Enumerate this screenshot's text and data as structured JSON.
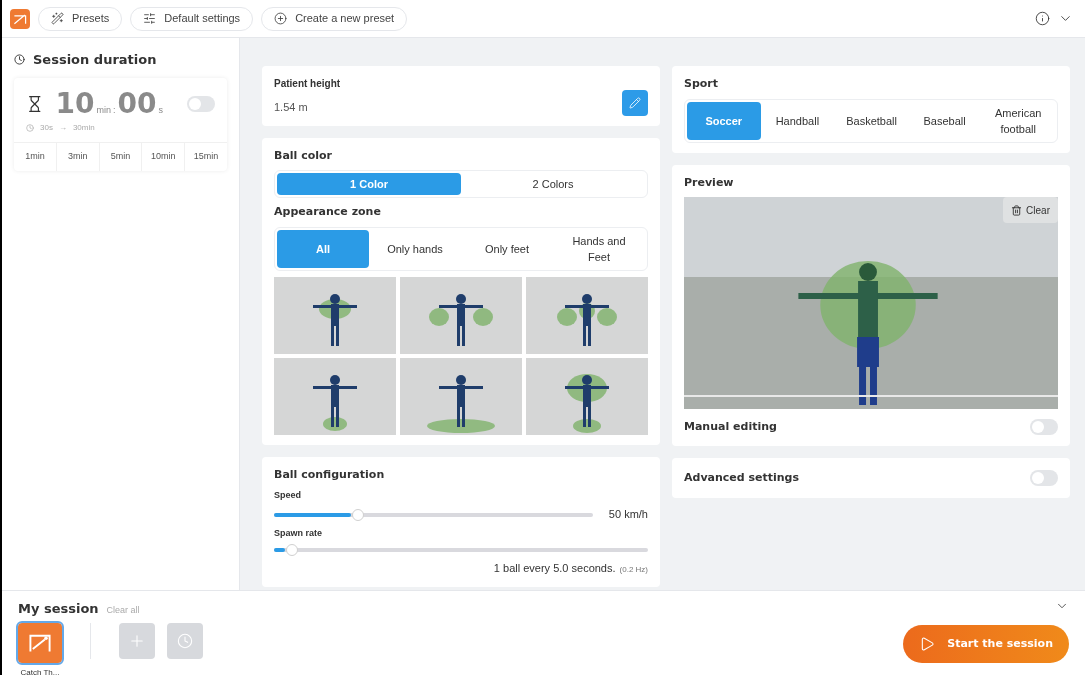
{
  "toolbar": {
    "buttons": [
      {
        "kind": "wand",
        "label": "Presets"
      },
      {
        "kind": "sliders",
        "label": "Default settings"
      },
      {
        "kind": "plus",
        "label": "Create a new preset"
      }
    ]
  },
  "session_duration": {
    "title": "Session duration",
    "minutes": "10",
    "min_unit": "min",
    "separator": ":",
    "seconds": "00",
    "sec_unit": "s",
    "timer_on": false,
    "range_min": "30s",
    "range_arrow": "→",
    "range_max": "30min",
    "presets": [
      "1min",
      "3min",
      "5min",
      "10min",
      "15min"
    ]
  },
  "patient_height": {
    "label": "Patient height",
    "value": "1.54 m"
  },
  "ball_color": {
    "title": "Ball color",
    "options": [
      {
        "label": "1 Color",
        "selected": true
      },
      {
        "label": "2 Colors",
        "selected": false
      }
    ]
  },
  "appearance_zone": {
    "title": "Appearance zone",
    "options": [
      {
        "label": "All",
        "selected": true
      },
      {
        "label": "Only hands",
        "selected": false
      },
      {
        "label": "Only feet",
        "selected": false
      },
      {
        "label": "Hands and Feet",
        "selected": false
      }
    ],
    "thumbnails": [
      {
        "kind": "chest"
      },
      {
        "kind": "hands"
      },
      {
        "kind": "hands-chest"
      },
      {
        "kind": "feet"
      },
      {
        "kind": "feet-wide"
      },
      {
        "kind": "chest-feet"
      }
    ]
  },
  "ball_configuration": {
    "title": "Ball configuration",
    "sliders": [
      {
        "label": "Speed",
        "level": 0.24,
        "reading": "50 km/h"
      },
      {
        "label": "Spawn rate",
        "level": 0.03,
        "reading": "1 ball every 5.0 seconds.",
        "note": "(0.2 Hz)"
      }
    ]
  },
  "sport": {
    "title": "Sport",
    "options": [
      {
        "label": "Soccer",
        "selected": true
      },
      {
        "label": "Handball",
        "selected": false
      },
      {
        "label": "Basketball",
        "selected": false
      },
      {
        "label": "Baseball",
        "selected": false
      },
      {
        "label": "American football",
        "selected": false
      }
    ]
  },
  "preview": {
    "title": "Preview",
    "clear": "Clear",
    "manual_editing": {
      "label": "Manual editing",
      "on": false
    }
  },
  "advanced_settings": {
    "label": "Advanced settings",
    "on": false
  },
  "my_session": {
    "title": "My session",
    "clear_all": "Clear all",
    "items": [
      {
        "label": "Catch Th...",
        "selected": true
      }
    ],
    "start": "Start the session"
  }
}
